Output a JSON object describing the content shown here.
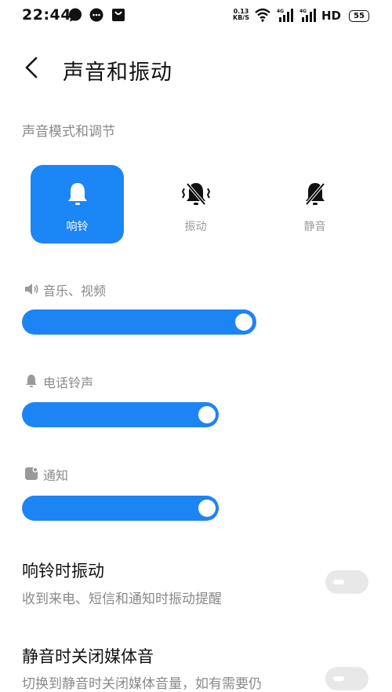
{
  "status_bar": {
    "time": "22:44",
    "net_speed_value": "0.13",
    "net_speed_unit": "KB/S",
    "hd_label": "HD",
    "battery": "55"
  },
  "header": {
    "title": "声音和振动"
  },
  "sound_mode": {
    "section_title": "声音模式和调节",
    "modes": [
      {
        "label": "响铃",
        "active": true
      },
      {
        "label": "振动",
        "active": false
      },
      {
        "label": "静音",
        "active": false
      }
    ]
  },
  "volumes": [
    {
      "label": "音乐、视频",
      "icon": "speaker-icon",
      "level": 1.0
    },
    {
      "label": "电话铃声",
      "icon": "bell-icon",
      "level": 1.0
    },
    {
      "label": "通知",
      "icon": "notification-icon",
      "level": 1.0
    }
  ],
  "settings": [
    {
      "title": "响铃时振动",
      "desc": "收到来电、短信和通知时振动提醒",
      "enabled": false
    },
    {
      "title": "静音时关闭媒体音",
      "desc": "切换到静音时关闭媒体音量，如有需要仍",
      "enabled": false
    }
  ],
  "colors": {
    "accent": "#1b86f5",
    "secondary_text": "#8a8a8a",
    "toggle_off": "#e8e8e8"
  }
}
